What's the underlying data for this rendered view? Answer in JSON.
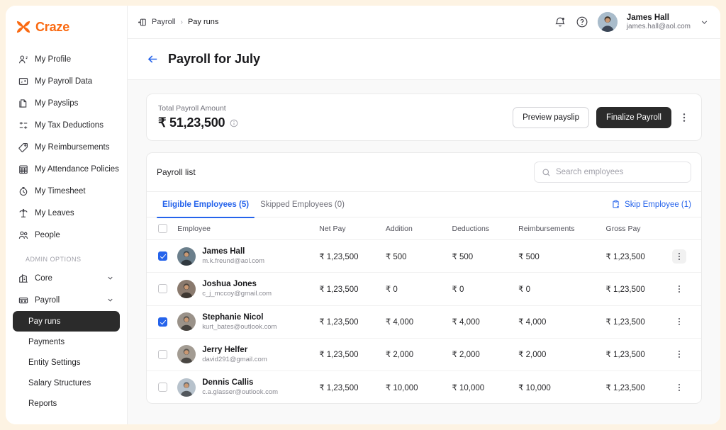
{
  "brand": {
    "name": "Craze",
    "color": "#FA6A12"
  },
  "sidebar": {
    "items": [
      {
        "label": "My Profile",
        "icon": "user-icon"
      },
      {
        "label": "My Payroll Data",
        "icon": "payroll-data-icon"
      },
      {
        "label": "My Payslips",
        "icon": "document-icon"
      },
      {
        "label": "My Tax Deductions",
        "icon": "sliders-icon"
      },
      {
        "label": "My Reimbursements",
        "icon": "tag-icon"
      },
      {
        "label": "My Attendance Policies",
        "icon": "calendar-grid-icon"
      },
      {
        "label": "My Timesheet",
        "icon": "timer-icon"
      },
      {
        "label": "My Leaves",
        "icon": "palm-tree-icon"
      },
      {
        "label": "People",
        "icon": "people-icon"
      }
    ],
    "section_title": "ADMIN OPTIONS",
    "groups": [
      {
        "label": "Core",
        "icon": "building-icon",
        "expanded": false,
        "children": []
      },
      {
        "label": "Payroll",
        "icon": "wallet-icon",
        "expanded": true,
        "children": [
          {
            "label": "Pay runs",
            "active": true
          },
          {
            "label": "Payments",
            "active": false
          },
          {
            "label": "Entity Settings",
            "active": false
          },
          {
            "label": "Salary Structures",
            "active": false
          },
          {
            "label": "Reports",
            "active": false
          }
        ]
      }
    ]
  },
  "topbar": {
    "breadcrumb": [
      {
        "label": "Payroll",
        "current": false
      },
      {
        "label": "Pay runs",
        "current": true
      }
    ],
    "separator": "›",
    "user": {
      "name": "James Hall",
      "email": "james.hall@aol.com"
    }
  },
  "page": {
    "title": "Payroll for July"
  },
  "summary": {
    "label": "Total Payroll Amount",
    "amount": "₹ 51,23,500",
    "preview_label": "Preview payslip",
    "finalize_label": "Finalize Payroll"
  },
  "list": {
    "title": "Payroll list",
    "search_placeholder": "Search employees",
    "search_value": "",
    "tabs": [
      {
        "label": "Eligible Employees (5)",
        "active": true
      },
      {
        "label": "Skipped Employees (0)",
        "active": false
      }
    ],
    "skip_action": "Skip Employee (1)",
    "columns": [
      "Employee",
      "Net Pay",
      "Addition",
      "Deductions",
      "Reimbursements",
      "Gross Pay"
    ],
    "header_checked": false,
    "rows": [
      {
        "checked": true,
        "hovered": true,
        "name": "James Hall",
        "email": "m.k.freund@aol.com",
        "net_pay": "₹ 1,23,500",
        "addition": "₹ 500",
        "deductions": "₹ 500",
        "reimbursements": "₹ 500",
        "gross_pay": "₹ 1,23,500",
        "avatar_color": "#6B7F8C"
      },
      {
        "checked": false,
        "hovered": false,
        "name": "Joshua Jones",
        "email": "c_j_mccoy@gmail.com",
        "net_pay": "₹ 1,23,500",
        "addition": "₹ 0",
        "deductions": "₹ 0",
        "reimbursements": "₹ 0",
        "gross_pay": "₹ 1,23,500",
        "avatar_color": "#8A7A6E"
      },
      {
        "checked": true,
        "hovered": false,
        "name": "Stephanie Nicol",
        "email": "kurt_bates@outlook.com",
        "net_pay": "₹ 1,23,500",
        "addition": "₹ 4,000",
        "deductions": "₹ 4,000",
        "reimbursements": "₹ 4,000",
        "gross_pay": "₹ 1,23,500",
        "avatar_color": "#9A9289"
      },
      {
        "checked": false,
        "hovered": false,
        "name": "Jerry Helfer",
        "email": "david291@gmail.com",
        "net_pay": "₹ 1,23,500",
        "addition": "₹ 2,000",
        "deductions": "₹ 2,000",
        "reimbursements": "₹ 2,000",
        "gross_pay": "₹ 1,23,500",
        "avatar_color": "#A39C93"
      },
      {
        "checked": false,
        "hovered": false,
        "name": "Dennis Callis",
        "email": "c.a.glasser@outlook.com",
        "net_pay": "₹ 1,23,500",
        "addition": "₹ 10,000",
        "deductions": "₹ 10,000",
        "reimbursements": "₹ 10,000",
        "gross_pay": "₹ 1,23,500",
        "avatar_color": "#B7C2CC"
      }
    ]
  },
  "colors": {
    "accent_blue": "#2563EB",
    "dark": "#2B2B2B",
    "page_bg": "#FDF3E3"
  }
}
